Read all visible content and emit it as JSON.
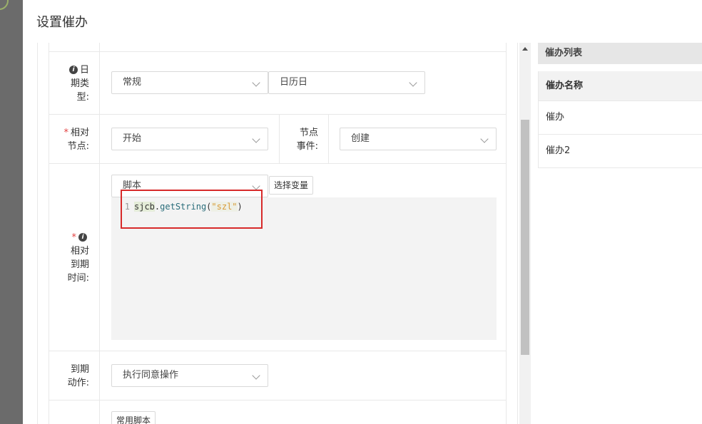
{
  "dialog": {
    "title": "设置催办"
  },
  "form": {
    "date_type": {
      "label": "日期类型:",
      "label_lines": [
        "日",
        "期类",
        "型:"
      ],
      "select1": "常规",
      "select2": "日历日"
    },
    "relative_node": {
      "label_lines": [
        "相对",
        "节点:"
      ],
      "select": "开始",
      "node_event_label_lines": [
        "节点",
        "事件:"
      ],
      "node_event_select": "创建"
    },
    "relative_due": {
      "label_lines": [
        "相对",
        "到期",
        "时间:"
      ],
      "mode_select": "脚本",
      "choose_var_button": "选择变量",
      "code": {
        "line_no": "1",
        "var": "sjcb",
        "dot": ".",
        "fn": "getString",
        "open": "(",
        "str": "\"szl\"",
        "close": ")"
      }
    },
    "due_action": {
      "label_lines": [
        "到期",
        "动作:"
      ],
      "select": "执行同意操作"
    },
    "common_script_button": "常用脚本"
  },
  "right_panel": {
    "title": "催办列表",
    "header": "催办名称",
    "rows": [
      "催办",
      "催办2"
    ]
  },
  "colors": {
    "required": "#e34242",
    "highlight_box": "#d72a2a",
    "editor_bg": "#f3f3f3"
  }
}
